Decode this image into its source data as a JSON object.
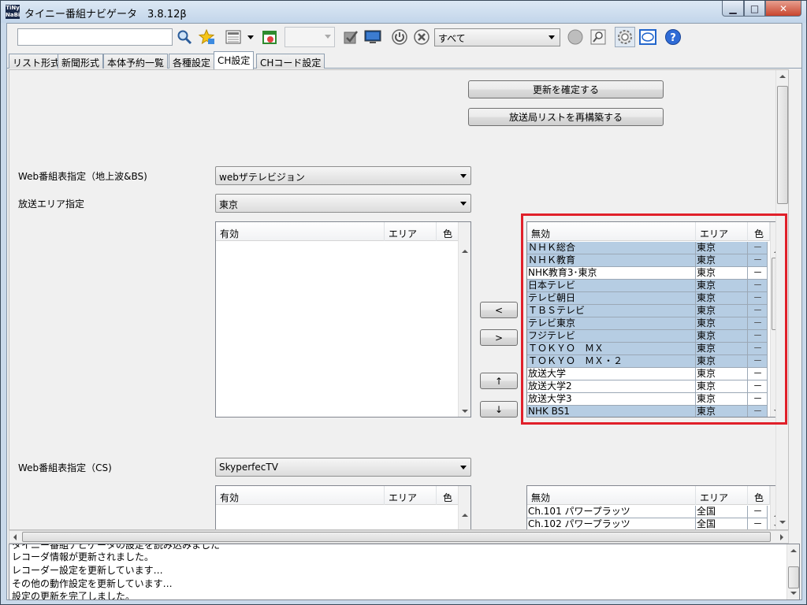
{
  "window": {
    "title": "タイニー番組ナビゲータ　3.8.12β",
    "app_icon_text": "TiNy NaBi",
    "controls": {
      "minimize": "▁",
      "maximize": "□",
      "close": "✕"
    }
  },
  "toolbar": {
    "search_value": "",
    "filter_value": "すべて",
    "icons": [
      "search-icon",
      "favorites-icon",
      "list-view-icon",
      "calendar-icon",
      "check-icon",
      "monitor-icon",
      "power-icon",
      "cancel-icon",
      "status-icon",
      "zoom-icon",
      "settings-icon",
      "screen-icon",
      "help-icon"
    ]
  },
  "tabs": [
    {
      "label": "リスト形式",
      "active": false
    },
    {
      "label": "新聞形式",
      "active": false
    },
    {
      "label": "本体予約一覧",
      "active": false
    },
    {
      "label": "各種設定",
      "active": false
    },
    {
      "label": "CH設定",
      "active": true
    },
    {
      "label": "CHコード設定",
      "active": false
    }
  ],
  "ch_settings": {
    "update_button": "更新を確定する",
    "rebuild_button": "放送局リストを再構築する",
    "terrestrial": {
      "web_label": "Web番組表指定（地上波&BS)",
      "web_value": "webザテレビジョン",
      "area_label": "放送エリア指定",
      "area_value": "東京",
      "enabled_headers": {
        "name": "有効",
        "area": "エリア",
        "color": "色"
      },
      "disabled_headers": {
        "name": "無効",
        "area": "エリア",
        "color": "色"
      },
      "disabled_rows": [
        {
          "name": "ＮＨＫ総合",
          "area": "東京",
          "color": "－",
          "selected": true
        },
        {
          "name": "ＮＨＫ教育",
          "area": "東京",
          "color": "－",
          "selected": true
        },
        {
          "name": "NHK教育3･東京",
          "area": "東京",
          "color": "－",
          "selected": false
        },
        {
          "name": "日本テレビ",
          "area": "東京",
          "color": "－",
          "selected": true
        },
        {
          "name": "テレビ朝日",
          "area": "東京",
          "color": "－",
          "selected": true
        },
        {
          "name": "ＴＢＳテレビ",
          "area": "東京",
          "color": "－",
          "selected": true
        },
        {
          "name": "テレビ東京",
          "area": "東京",
          "color": "－",
          "selected": true
        },
        {
          "name": "フジテレビ",
          "area": "東京",
          "color": "－",
          "selected": true
        },
        {
          "name": "ＴＯＫＹＯ　ＭＸ",
          "area": "東京",
          "color": "－",
          "selected": true
        },
        {
          "name": "ＴＯＫＹＯ　ＭＸ・２",
          "area": "東京",
          "color": "－",
          "selected": true
        },
        {
          "name": "放送大学",
          "area": "東京",
          "color": "－",
          "selected": false
        },
        {
          "name": "放送大学2",
          "area": "東京",
          "color": "－",
          "selected": false
        },
        {
          "name": "放送大学3",
          "area": "東京",
          "color": "－",
          "selected": false
        },
        {
          "name": "NHK BS1",
          "area": "東京",
          "color": "－",
          "selected": true
        }
      ]
    },
    "move_buttons": {
      "left": "<",
      "right": ">",
      "up": "↑",
      "down": "↓"
    },
    "cs": {
      "web_label": "Web番組表指定（CS)",
      "web_value": "SkyperfecTV",
      "enabled_headers": {
        "name": "有効",
        "area": "エリア",
        "color": "色"
      },
      "disabled_headers": {
        "name": "無効",
        "area": "エリア",
        "color": "色"
      },
      "disabled_rows": [
        {
          "name": "Ch.101 パワープラッツ",
          "area": "全国",
          "color": "－"
        },
        {
          "name": "Ch.102 パワープラッツ",
          "area": "全国",
          "color": "－"
        }
      ]
    }
  },
  "log": {
    "lines": [
      "タイニー番組ナビゲータの設定を読み込みました",
      "レコーダ情報が更新されました。",
      "レコーダー設定を更新しています…",
      "その他の動作設定を更新しています…",
      "設定の更新を完了しました。"
    ]
  }
}
